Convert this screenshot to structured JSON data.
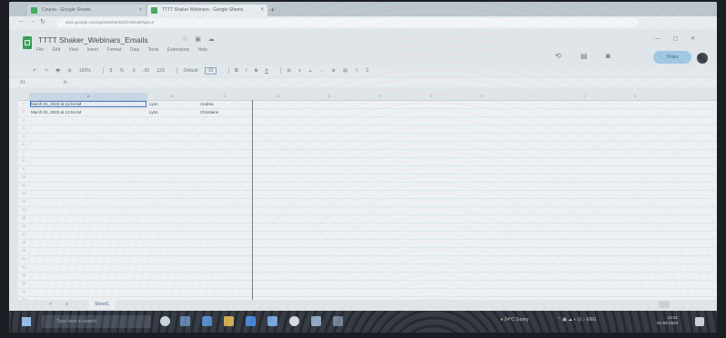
{
  "browser": {
    "tabs": [
      {
        "label": "Course - Google Sheets",
        "favicon_color": "#34a853"
      },
      {
        "label": "TTTT Shaker Webinars - Google Sheets",
        "favicon_color": "#34a853"
      }
    ],
    "new_tab_symbol": "+",
    "address": "docs.google.com/spreadsheets/d/1Xk/edit#gid=0",
    "nav": {
      "back": "←",
      "forward": "→",
      "reload": "↻"
    }
  },
  "sheets": {
    "doc_title": "TTTT Shaker_Webinars_Emails",
    "title_icons": "☆ ▣ ☁",
    "menu": [
      "File",
      "Edit",
      "View",
      "Insert",
      "Format",
      "Data",
      "Tools",
      "Extensions",
      "Help"
    ],
    "share_label": "Share",
    "window_controls": "— ▢ ✕",
    "toolbar": {
      "zoom": "100%",
      "font": "Default",
      "font_size": "10",
      "buttons": [
        "↶",
        "↷",
        "🖶",
        "⊞",
        "$",
        "%",
        ".0",
        ".00",
        "123",
        "B",
        "I",
        "S",
        "A",
        "⊞",
        "≡",
        "⟂",
        "⇔",
        "⊕",
        "▤",
        "▽",
        "Σ"
      ]
    },
    "name_box": "A1",
    "formula_icon": "fx",
    "columns": [
      "",
      "A",
      "B",
      "C",
      "D",
      "E",
      "F",
      "G",
      "H",
      "I",
      "J",
      "K"
    ],
    "rows": [
      {
        "num": "1",
        "a": "March 01, 2023 at 11:51AM",
        "b": "Lynn",
        "c": "Andrea"
      },
      {
        "num": "2",
        "a": "March 01, 2023 at 11:51AM",
        "b": "Lynn",
        "c": "Christians"
      }
    ],
    "row_numbers": [
      "3",
      "4",
      "5",
      "6",
      "7",
      "8",
      "9",
      "10",
      "11",
      "12",
      "13",
      "14",
      "15",
      "16",
      "17",
      "18",
      "19",
      "20",
      "21",
      "22",
      "23",
      "24",
      "25"
    ],
    "sheet_tab": "Sheet1",
    "add_sheet": "+",
    "all_sheets": "≡"
  },
  "taskbar": {
    "search_placeholder": "Type here to search",
    "tray_text": "24°C  Sunny",
    "clock_time": "12:51",
    "clock_date": "01-03-2023"
  }
}
